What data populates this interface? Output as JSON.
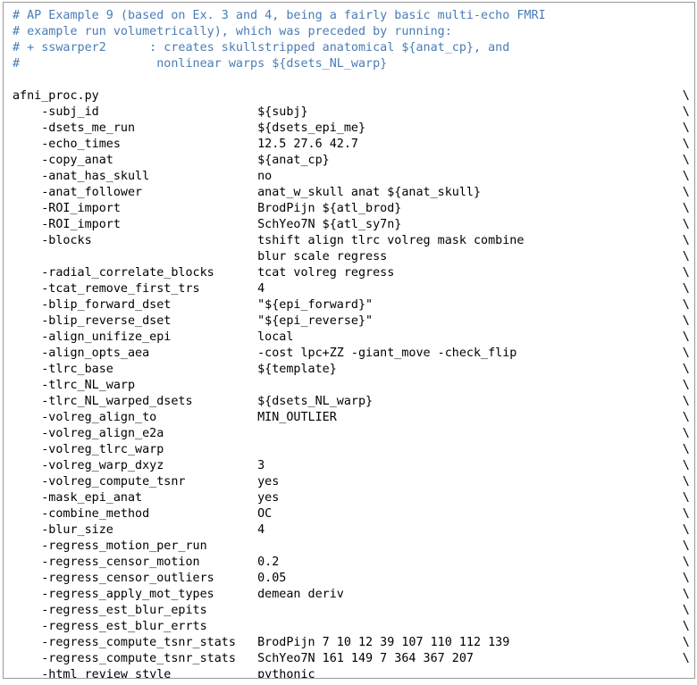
{
  "window": {
    "kind": "code-block",
    "background_color": "#ffffff",
    "border_color": "#999999",
    "text_color": "#000000",
    "comment_color": "#4a7cb5",
    "font_family_kind": "monospace"
  },
  "code": {
    "comment_header": [
      "# AP Example 9 (based on Ex. 3 and 4, being a fairly basic multi-echo FMRI",
      "# example run volumetrically), which was preceded by running:",
      "# + sswarper2      : creates skullstripped anatomical ${anat_cp}, and",
      "#                   nonlinear warps ${dsets_NL_warp}"
    ],
    "blank_line": "",
    "command_name": "afni_proc.py",
    "command_continuation": "\\",
    "indent": "    ",
    "option_column_width": 30,
    "continuation_column": 93,
    "options": [
      {
        "option": "-subj_id",
        "value": "${subj}",
        "cont": "\\"
      },
      {
        "option": "-dsets_me_run",
        "value": "${dsets_epi_me}",
        "cont": "\\"
      },
      {
        "option": "-echo_times",
        "value": "12.5 27.6 42.7",
        "cont": "\\"
      },
      {
        "option": "-copy_anat",
        "value": "${anat_cp}",
        "cont": "\\"
      },
      {
        "option": "-anat_has_skull",
        "value": "no",
        "cont": "\\"
      },
      {
        "option": "-anat_follower",
        "value": "anat_w_skull anat ${anat_skull}",
        "cont": "\\"
      },
      {
        "option": "-ROI_import",
        "value": "BrodPijn ${atl_brod}",
        "cont": "\\"
      },
      {
        "option": "-ROI_import",
        "value": "SchYeo7N ${atl_sy7n}",
        "cont": "\\"
      },
      {
        "option": "-blocks",
        "value": "tshift align tlrc volreg mask combine",
        "cont": "\\"
      },
      {
        "option": "",
        "value": "blur scale regress",
        "cont": "\\"
      },
      {
        "option": "-radial_correlate_blocks",
        "value": "tcat volreg regress",
        "cont": "\\"
      },
      {
        "option": "-tcat_remove_first_trs",
        "value": "4",
        "cont": "\\"
      },
      {
        "option": "-blip_forward_dset",
        "value": "\"${epi_forward}\"",
        "cont": "\\"
      },
      {
        "option": "-blip_reverse_dset",
        "value": "\"${epi_reverse}\"",
        "cont": "\\"
      },
      {
        "option": "-align_unifize_epi",
        "value": "local",
        "cont": "\\"
      },
      {
        "option": "-align_opts_aea",
        "value": "-cost lpc+ZZ -giant_move -check_flip",
        "cont": "\\"
      },
      {
        "option": "-tlrc_base",
        "value": "${template}",
        "cont": "\\"
      },
      {
        "option": "-tlrc_NL_warp",
        "value": "",
        "cont": "\\"
      },
      {
        "option": "-tlrc_NL_warped_dsets",
        "value": "${dsets_NL_warp}",
        "cont": "\\"
      },
      {
        "option": "-volreg_align_to",
        "value": "MIN_OUTLIER",
        "cont": "\\"
      },
      {
        "option": "-volreg_align_e2a",
        "value": "",
        "cont": "\\"
      },
      {
        "option": "-volreg_tlrc_warp",
        "value": "",
        "cont": "\\"
      },
      {
        "option": "-volreg_warp_dxyz",
        "value": "3",
        "cont": "\\"
      },
      {
        "option": "-volreg_compute_tsnr",
        "value": "yes",
        "cont": "\\"
      },
      {
        "option": "-mask_epi_anat",
        "value": "yes",
        "cont": "\\"
      },
      {
        "option": "-combine_method",
        "value": "OC",
        "cont": "\\"
      },
      {
        "option": "-blur_size",
        "value": "4",
        "cont": "\\"
      },
      {
        "option": "-regress_motion_per_run",
        "value": "",
        "cont": "\\"
      },
      {
        "option": "-regress_censor_motion",
        "value": "0.2",
        "cont": "\\"
      },
      {
        "option": "-regress_censor_outliers",
        "value": "0.05",
        "cont": "\\"
      },
      {
        "option": "-regress_apply_mot_types",
        "value": "demean deriv",
        "cont": "\\"
      },
      {
        "option": "-regress_est_blur_epits",
        "value": "",
        "cont": "\\"
      },
      {
        "option": "-regress_est_blur_errts",
        "value": "",
        "cont": "\\"
      },
      {
        "option": "-regress_compute_tsnr_stats",
        "value": "BrodPijn 7 10 12 39 107 110 112 139",
        "cont": "\\"
      },
      {
        "option": "-regress_compute_tsnr_stats",
        "value": "SchYeo7N 161 149 7 364 367 207",
        "cont": "\\"
      },
      {
        "option": "-html_review_style",
        "value": "pythonic",
        "cont": ""
      }
    ]
  }
}
